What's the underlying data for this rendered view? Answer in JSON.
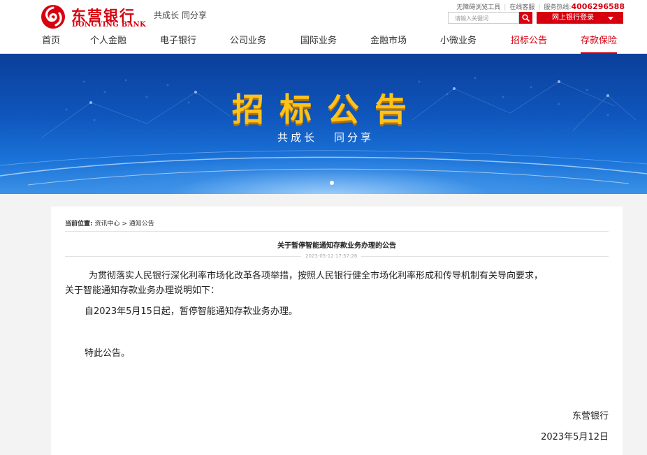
{
  "header": {
    "logo_cn": "东营银行",
    "logo_en": "DONGYING BANK",
    "slogan": "共成长  同分享",
    "toplinks": {
      "accessibility": "无障碍浏览工具",
      "online_service": "在线客服",
      "hotline_label": "服务热线:",
      "hotline_number": "4006296588"
    },
    "search_placeholder": "请输入关键词",
    "ebank_login": "网上银行登录"
  },
  "nav": {
    "items": [
      {
        "label": "首页"
      },
      {
        "label": "个人金融"
      },
      {
        "label": "电子银行"
      },
      {
        "label": "公司业务"
      },
      {
        "label": "国际业务"
      },
      {
        "label": "金融市场"
      },
      {
        "label": "小微业务"
      },
      {
        "label": "招标公告"
      },
      {
        "label": "存款保险"
      }
    ]
  },
  "banner": {
    "title": "招标公告",
    "sub_left": "共成长",
    "sub_right": "同分享"
  },
  "breadcrumb": {
    "label": "当前位置:",
    "path": "资讯中心 > 通知公告"
  },
  "article": {
    "title": "关于暂停智能通知存款业务办理的公告",
    "date": "2023-05-12 17:57:26",
    "para1_line1": "为贯彻落实人民银行深化利率市场化改革各项举措，按照人民银行健全市场化利率形成和传导机制有关导向要求，",
    "para1_line2": "关于智能通知存款业务办理说明如下：",
    "para2": "自2023年5月15日起，暂停智能通知存款业务办理。",
    "para3": "特此公告。",
    "signer": "东营银行",
    "sign_date": "2023年5月12日"
  },
  "colors": {
    "brand_red": "#d7000f",
    "banner_gold": "#ffc21a",
    "banner_blue": "#0f56bd"
  }
}
